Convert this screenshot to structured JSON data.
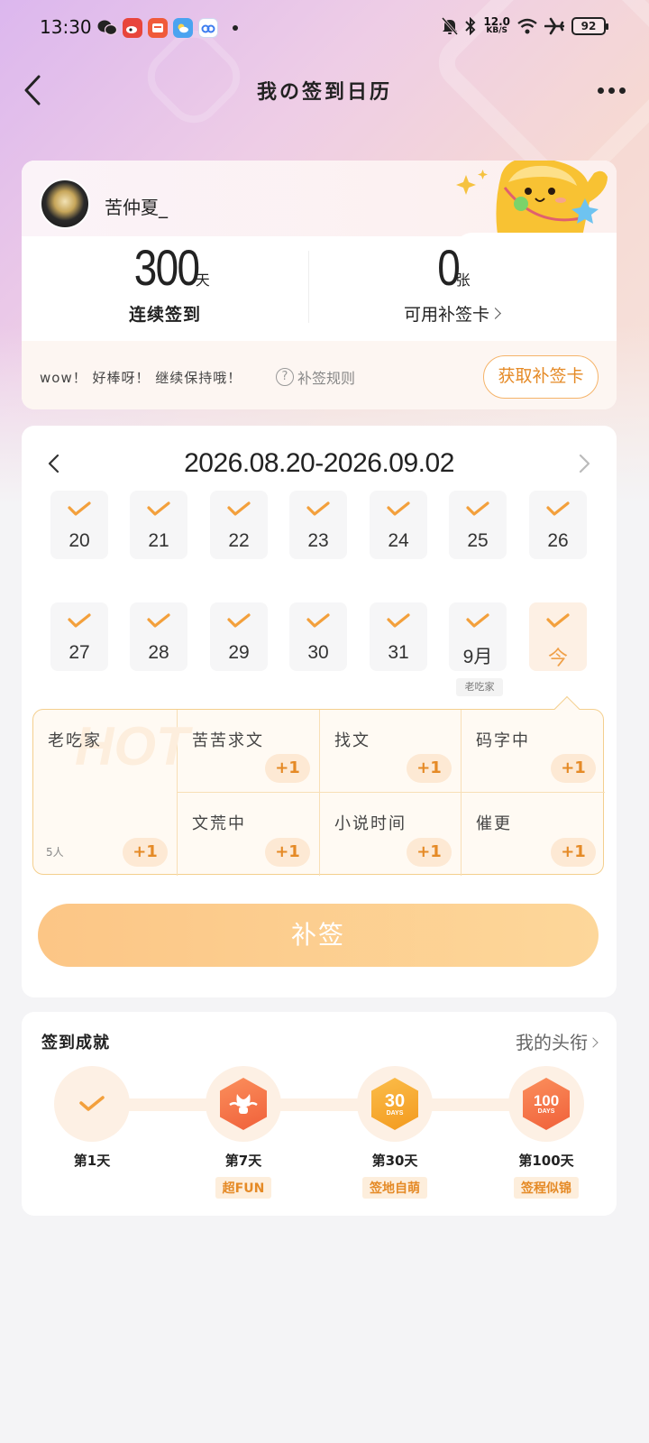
{
  "status_bar": {
    "time": "13:30",
    "net_speed_value": "12.0",
    "net_speed_unit": "KB/S",
    "battery": "92"
  },
  "nav": {
    "title": "我の签到日历"
  },
  "profile": {
    "username": "苦仲夏_",
    "streak_value": "300",
    "streak_unit": "天",
    "streak_label": "连续签到",
    "cards_value": "0",
    "cards_unit": "张",
    "cards_label": "可用补签卡",
    "tip": "wow！ 好棒呀！ 继续保持哦！",
    "rules_label": "补签规则",
    "rules_icon": "?",
    "get_card_label": "获取补签卡"
  },
  "calendar": {
    "range": "2026.08.20-2026.09.02",
    "days": [
      {
        "label": "20",
        "checked": true
      },
      {
        "label": "21",
        "checked": true
      },
      {
        "label": "22",
        "checked": true
      },
      {
        "label": "23",
        "checked": true
      },
      {
        "label": "24",
        "checked": true
      },
      {
        "label": "25",
        "checked": true
      },
      {
        "label": "26",
        "checked": true
      },
      {
        "label": "27",
        "checked": true
      },
      {
        "label": "28",
        "checked": true
      },
      {
        "label": "29",
        "checked": true
      },
      {
        "label": "30",
        "checked": true
      },
      {
        "label": "31",
        "checked": true
      },
      {
        "label": "9月",
        "checked": true
      },
      {
        "label": "今",
        "checked": true
      }
    ],
    "day_tag": "老吃家",
    "hot_watermark": "HOT",
    "tags": [
      {
        "name": "老吃家",
        "plus": "+1",
        "count": "5人"
      },
      {
        "name": "苦苦求文",
        "plus": "+1"
      },
      {
        "name": "找文",
        "plus": "+1"
      },
      {
        "name": "码字中",
        "plus": "+1"
      },
      {
        "name": "文荒中",
        "plus": "+1"
      },
      {
        "name": "小说时间",
        "plus": "+1"
      },
      {
        "name": "催更",
        "plus": "+1"
      }
    ],
    "resign_label": "补签"
  },
  "achievements": {
    "title": "签到成就",
    "link": "我的头衔",
    "items": [
      {
        "day": "第1天",
        "badge": "",
        "done": true
      },
      {
        "day": "第7天",
        "badge": "超FUN",
        "icon_text": ""
      },
      {
        "day": "第30天",
        "badge": "签地自萌",
        "icon_text": "30"
      },
      {
        "day": "第100天",
        "badge": "签程似锦",
        "icon_text": "100"
      }
    ],
    "icon_subtext": "DAYS"
  },
  "colors": {
    "accent": "#e58a26",
    "check": "#f3a03c",
    "button": "#fcc686"
  }
}
